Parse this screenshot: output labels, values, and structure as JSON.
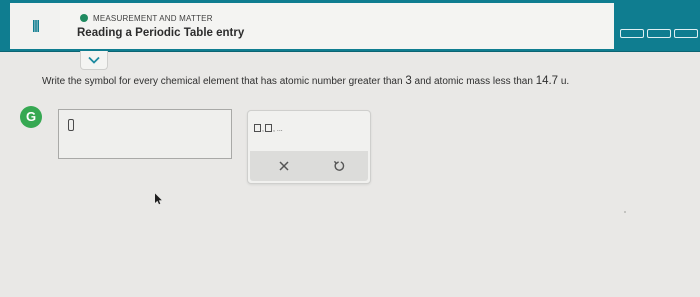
{
  "header": {
    "menu_icon": "hamburger-icon",
    "topic": "MEASUREMENT AND MATTER",
    "topic_status_color": "#1f8a60",
    "title": "Reading a Periodic Table entry",
    "collapse_icon": "chevron-down-icon",
    "progress_segments_count": 3,
    "accent_color": "#0f7d90"
  },
  "question": {
    "prefix": "Write the symbol for every chemical element that has atomic number greater than",
    "number_one": "3",
    "middle": "and atomic mass less than",
    "number_two": "14.7",
    "unit": "u."
  },
  "badge": {
    "letter": "G",
    "color": "#36a852"
  },
  "answer": {
    "value": ""
  },
  "palette": {
    "key_separator": ",",
    "key_ellipsis": "...",
    "clear_icon": "close-icon",
    "undo_icon": "undo-icon"
  }
}
